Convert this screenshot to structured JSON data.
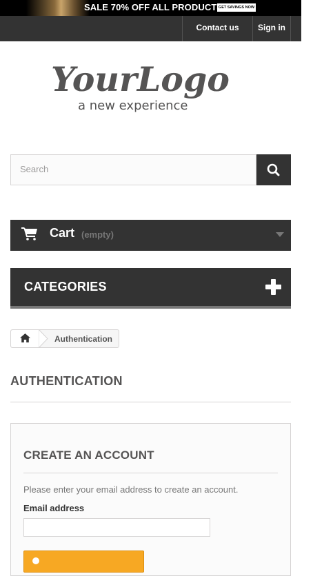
{
  "banner": {
    "sale_text": "SALE 70% OFF ALL PRODUCTS",
    "savings_label": "GET SAVINGS NOW"
  },
  "topnav": {
    "contact": "Contact us",
    "signin": "Sign in"
  },
  "logo": {
    "main": "YourLogo",
    "tagline": "a new experience"
  },
  "search": {
    "placeholder": "Search",
    "button_icon": "search-icon"
  },
  "cart": {
    "label": "Cart",
    "status": "(empty)",
    "icon": "cart-icon"
  },
  "categories": {
    "label": "CATEGORIES",
    "icon": "plus-icon"
  },
  "breadcrumb": {
    "home_icon": "home-icon",
    "current": "Authentication"
  },
  "page": {
    "heading": "AUTHENTICATION"
  },
  "create_account": {
    "title": "CREATE AN ACCOUNT",
    "hint": "Please enter your email address to create an account.",
    "email_label": "Email address",
    "email_value": ""
  },
  "colors": {
    "dark": "#333333",
    "accent": "#f7a823",
    "border": "#d6d4d4"
  }
}
